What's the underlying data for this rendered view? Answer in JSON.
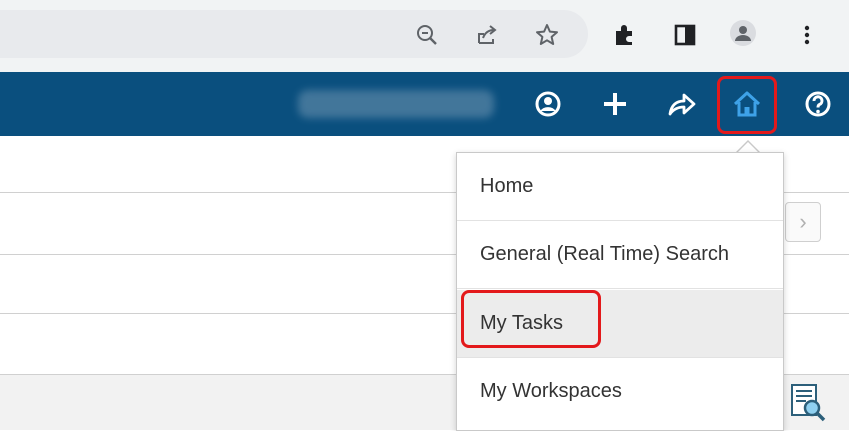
{
  "browser": {
    "icons": [
      "zoom-out-icon",
      "share-icon",
      "star-icon",
      "extensions-icon",
      "side-panel-icon",
      "profile-icon",
      "more-icon"
    ]
  },
  "header": {
    "user_name": "",
    "icons": [
      "user-icon",
      "plus-icon",
      "forward-icon",
      "home-icon",
      "help-icon"
    ],
    "home_icon_color": "#3ea2e8",
    "bg_color": "#0a4f7e"
  },
  "menu": {
    "items": [
      {
        "label": "Home"
      },
      {
        "label": "General (Real Time) Search"
      },
      {
        "label": "My Tasks"
      },
      {
        "label": "My Workspaces"
      }
    ],
    "active_item": "My Tasks"
  },
  "pagination": {
    "next_label": "›"
  },
  "annotation_color": "#e3191b"
}
